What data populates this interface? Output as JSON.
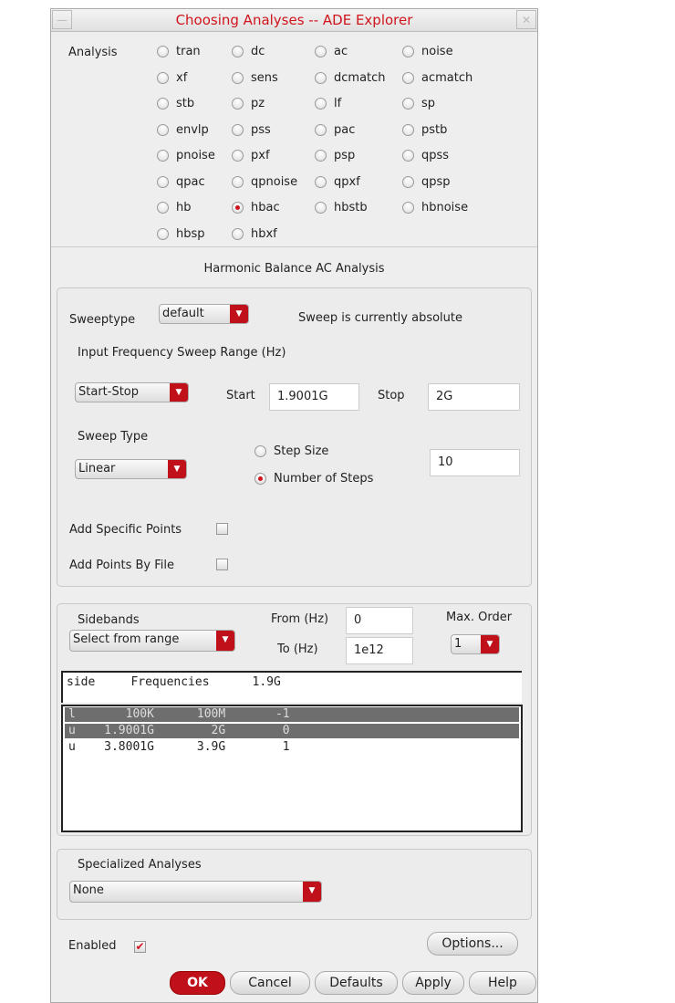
{
  "window": {
    "title": "Choosing Analyses -- ADE Explorer",
    "min_icon": "minimize-icon",
    "close_icon": "close-icon"
  },
  "analysis": {
    "label": "Analysis",
    "selected": "hbac",
    "options": [
      "tran",
      "dc",
      "ac",
      "noise",
      "xf",
      "sens",
      "dcmatch",
      "acmatch",
      "stb",
      "pz",
      "lf",
      "sp",
      "envlp",
      "pss",
      "pac",
      "pstb",
      "pnoise",
      "pxf",
      "psp",
      "qpss",
      "qpac",
      "qpnoise",
      "qpxf",
      "qpsp",
      "hb",
      "hbac",
      "hbstb",
      "hbnoise",
      "hbsp",
      "hbxf"
    ]
  },
  "section_title": "Harmonic Balance AC Analysis",
  "sweep": {
    "sweeptype_label": "Sweeptype",
    "sweeptype_value": "default",
    "status": "Sweep is currently absolute",
    "range_label": "Input Frequency Sweep Range (Hz)",
    "range_mode": "Start-Stop",
    "start_label": "Start",
    "start_value": "1.9001G",
    "stop_label": "Stop",
    "stop_value": "2G",
    "type_label": "Sweep Type",
    "type_value": "Linear",
    "step_size_label": "Step Size",
    "num_steps_label": "Number of Steps",
    "steps_value": "10",
    "specific_points_label": "Add Specific Points",
    "points_by_file_label": "Add Points By File"
  },
  "sidebands": {
    "label": "Sidebands",
    "mode": "Select from range",
    "from_label": "From (Hz)",
    "from_value": "0",
    "to_label": "To (Hz)",
    "to_value": "1e12",
    "max_order_label": "Max. Order",
    "max_order_value": "1",
    "header": "side     Frequencies      1.9G",
    "rows": [
      {
        "text": "l       100K      100M       -1",
        "selected": true
      },
      {
        "text": "u    1.9001G        2G        0",
        "selected": true
      },
      {
        "text": "u    3.8001G      3.9G        1",
        "selected": false
      }
    ]
  },
  "specialized": {
    "label": "Specialized Analyses",
    "value": "None"
  },
  "enabled": {
    "label": "Enabled",
    "checked": true
  },
  "buttons": {
    "options": "Options...",
    "ok": "OK",
    "cancel": "Cancel",
    "defaults": "Defaults",
    "apply": "Apply",
    "help": "Help"
  }
}
